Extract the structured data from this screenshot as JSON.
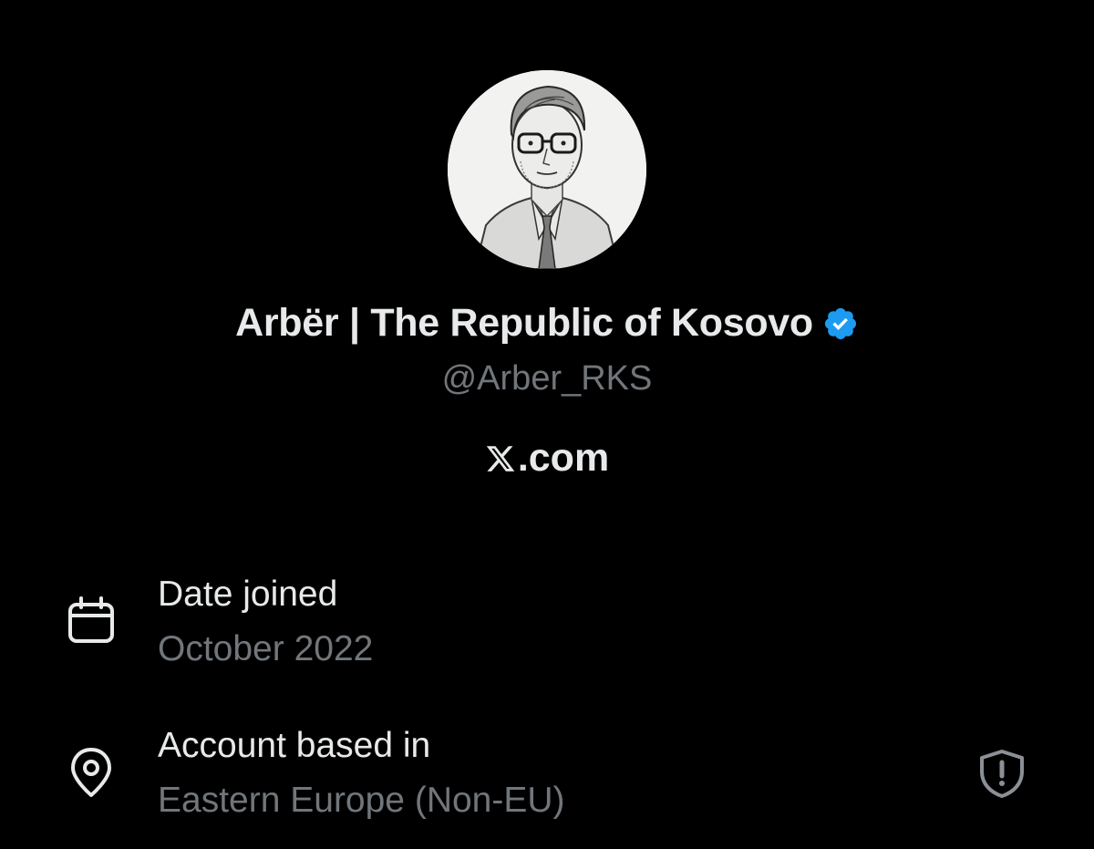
{
  "profile": {
    "display_name": "Arbër | The Republic of Kosovo",
    "handle": "@Arber_RKS",
    "verified": true,
    "avatar": "sketch-portrait-of-man-with-glasses",
    "website": ".com",
    "website_logo": "x-logo"
  },
  "details": {
    "date_joined": {
      "icon": "calendar-icon",
      "label": "Date joined",
      "value": "October 2022"
    },
    "based_in": {
      "icon": "location-pin-icon",
      "label": "Account based in",
      "value": "Eastern Europe (Non-EU)",
      "action_icon": "shield-alert-icon"
    }
  },
  "colors": {
    "background": "#000000",
    "primary_text": "#e7e9ea",
    "secondary_text": "#71767b",
    "verified_blue": "#1d9bf0"
  }
}
